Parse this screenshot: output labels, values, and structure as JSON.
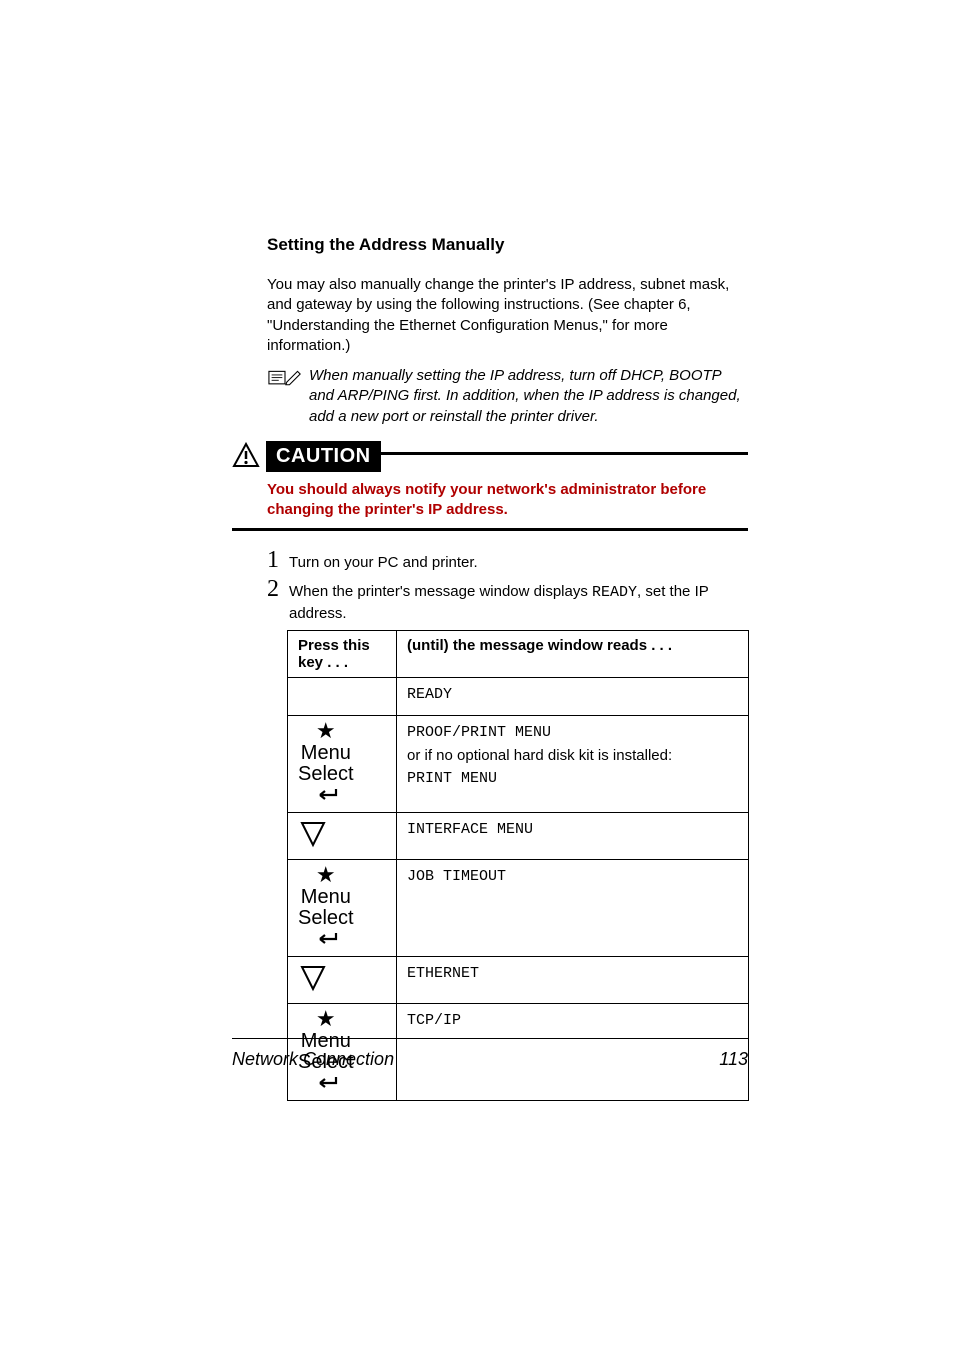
{
  "heading": "Setting the Address Manually",
  "intro": "You may also manually change the printer's IP address, subnet mask, and gateway by using the following instructions. (See chapter 6, \"Understanding the Ethernet Configuration Menus,\" for more information.)",
  "note": "When manually setting the IP address, turn off DHCP, BOOTP and ARP/PING first. In addition, when the IP address is changed, add a new port or reinstall the printer driver.",
  "caution": {
    "label": "CAUTION",
    "text": "You should always notify your network's administrator before changing the printer's IP address."
  },
  "steps": {
    "1": "Turn on your PC and printer.",
    "2_pre": "When the printer's message window displays ",
    "2_code": "READY",
    "2_post": ", set the IP address."
  },
  "table": {
    "headers": {
      "col1": "Press this key . . .",
      "col2": "(until) the message window reads  . . ."
    },
    "rows": {
      "r0": {
        "msg1": "READY"
      },
      "r1": {
        "msg1": "PROOF/PRINT MENU",
        "plain": "or if no optional hard disk kit is installed:",
        "msg2": "PRINT MENU"
      },
      "r2": {
        "msg1": "INTERFACE MENU"
      },
      "r3": {
        "msg1": "JOB TIMEOUT"
      },
      "r4": {
        "msg1": "ETHERNET"
      },
      "r5": {
        "msg1": "TCP/IP"
      }
    },
    "keyglyph": {
      "star": "★",
      "menu": "Menu",
      "select": "Select"
    }
  },
  "footer": {
    "left": "Network Connection",
    "right": "113"
  }
}
